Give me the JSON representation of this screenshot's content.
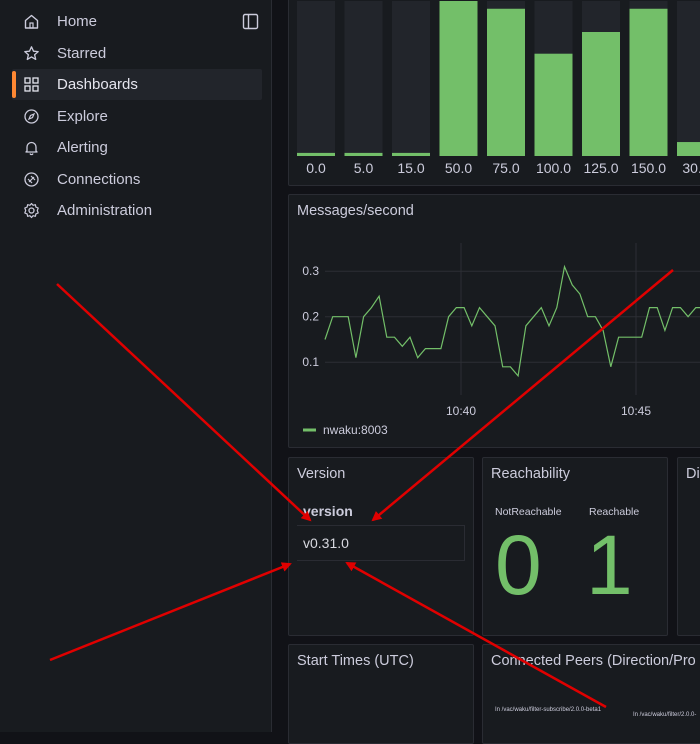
{
  "nav": {
    "items": [
      {
        "label": "Home",
        "icon": "home-icon"
      },
      {
        "label": "Starred",
        "icon": "star-icon"
      },
      {
        "label": "Dashboards",
        "icon": "dashboards-grid-icon",
        "active": true
      },
      {
        "label": "Explore",
        "icon": "compass-icon"
      },
      {
        "label": "Alerting",
        "icon": "bell-icon"
      },
      {
        "label": "Connections",
        "icon": "connections-icon"
      },
      {
        "label": "Administration",
        "icon": "gear-icon"
      }
    ]
  },
  "chart_data": [
    {
      "type": "bar",
      "title": "",
      "categories": [
        "0.0",
        "5.0",
        "15.0",
        "50.0",
        "75.0",
        "100.0",
        "125.0",
        "150.0",
        "30..."
      ],
      "values": [
        0.02,
        0.02,
        0.02,
        1.0,
        0.95,
        0.66,
        0.8,
        0.95,
        0.09
      ],
      "color": "#73bf69"
    },
    {
      "type": "line",
      "title": "Messages/second",
      "x_ticks": [
        "10:40",
        "10:45"
      ],
      "y_ticks": [
        "0.1",
        "0.2",
        "0.3"
      ],
      "ylim": [
        0.05,
        0.34
      ],
      "legend": "bottom-left",
      "series": [
        {
          "name": "nwaku:8003",
          "color": "#73bf69",
          "x": [
            0,
            1,
            2,
            3,
            4,
            5,
            6,
            7,
            8,
            9,
            10,
            11,
            12,
            13,
            14,
            15,
            16,
            17,
            18,
            19,
            20,
            21,
            22,
            23,
            24,
            25,
            26,
            27,
            28,
            29,
            30,
            31,
            32,
            33,
            34,
            35,
            36,
            37,
            38,
            39,
            40,
            41,
            42,
            43,
            44,
            45,
            46,
            47,
            48,
            49,
            50,
            51
          ],
          "values": [
            0.15,
            0.2,
            0.2,
            0.2,
            0.11,
            0.2,
            0.22,
            0.245,
            0.155,
            0.155,
            0.135,
            0.155,
            0.11,
            0.13,
            0.13,
            0.13,
            0.2,
            0.22,
            0.22,
            0.18,
            0.22,
            0.2,
            0.18,
            0.09,
            0.09,
            0.07,
            0.18,
            0.2,
            0.22,
            0.18,
            0.22,
            0.31,
            0.27,
            0.25,
            0.2,
            0.2,
            0.17,
            0.09,
            0.155,
            0.155,
            0.155,
            0.155,
            0.22,
            0.22,
            0.17,
            0.22,
            0.22,
            0.2,
            0.22,
            0.22,
            0.2,
            0.22
          ]
        }
      ]
    }
  ],
  "panels": {
    "version": {
      "title": "Version",
      "column_header": "version",
      "value": "v0.31.0"
    },
    "reachability": {
      "title": "Reachability",
      "labels": [
        "NotReachable",
        "Reachable"
      ],
      "values": [
        "0",
        "1"
      ]
    },
    "third": {
      "title": "Di"
    },
    "start_times": {
      "title": "Start Times (UTC)"
    },
    "connected_peers": {
      "title": "Connected Peers (Direction/Pro",
      "labels": [
        "In /vac/waku/filter-subscribe/2.0.0-beta1",
        "In /vac/waku/filter/2.0.0-"
      ]
    }
  },
  "colors": {
    "accent": "#73bf69",
    "active_marker": "#ff8833",
    "arrow": "#e00000"
  }
}
